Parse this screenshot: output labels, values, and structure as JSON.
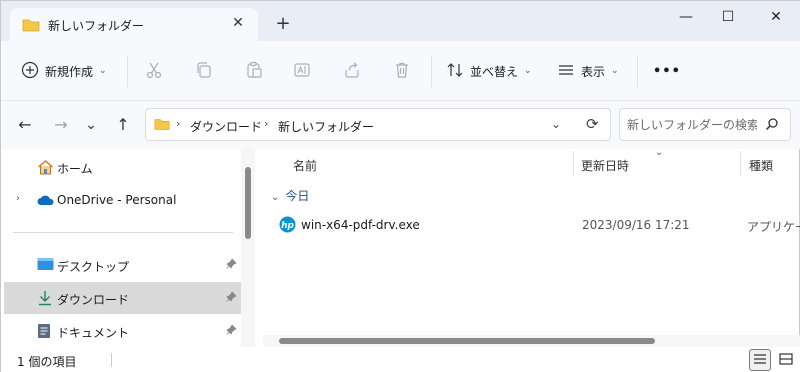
{
  "window": {
    "tab_title": "新しいフォルダー",
    "tab_close": "✕",
    "new_tab": "+",
    "minimize": "—",
    "maximize": "☐",
    "close": "✕"
  },
  "toolbar": {
    "new_label": "新規作成",
    "sort_label": "並べ替え",
    "view_label": "表示",
    "more_label": "•••",
    "icons": [
      "plus-circle-icon",
      "cut-icon",
      "copy-icon",
      "paste-icon",
      "rename-icon",
      "share-icon",
      "delete-icon",
      "sort-icon",
      "view-icon",
      "more-icon"
    ]
  },
  "nav": {
    "back": "←",
    "forward": "→",
    "recent": "⌄",
    "up": "↑"
  },
  "address": {
    "crumbs": [
      "ダウンロード",
      "新しいフォルダー"
    ],
    "separator": "›"
  },
  "search": {
    "placeholder": "新しいフォルダーの検索"
  },
  "sidebar": {
    "items": [
      {
        "label": "ホーム",
        "icon": "home-icon",
        "pinned": false
      },
      {
        "label": "OneDrive - Personal",
        "icon": "onedrive-cloud-icon",
        "pinned": false
      },
      {
        "label": "デスクトップ",
        "icon": "desktop-icon",
        "pinned": true
      },
      {
        "label": "ダウンロード",
        "icon": "download-icon",
        "pinned": true,
        "selected": true
      },
      {
        "label": "ドキュメント",
        "icon": "document-icon",
        "pinned": true
      }
    ],
    "expander": "›",
    "pin": "📌"
  },
  "filelist": {
    "columns": [
      "名前",
      "更新日時",
      "種類"
    ],
    "group_label": "今日",
    "rows": [
      {
        "name": "win-x64-pdf-drv.exe",
        "date": "2023/09/16 17:21",
        "type": "アプリケーション",
        "icon": "hp-logo-icon"
      }
    ]
  },
  "status": {
    "count": "1 個の項目"
  },
  "colors": {
    "accent": "#0067c0",
    "title_bg": "#e9eef6",
    "bar_bg": "#f7f9fc",
    "selected_bg": "#dadada",
    "folder_yellow": "#f4c74a"
  }
}
